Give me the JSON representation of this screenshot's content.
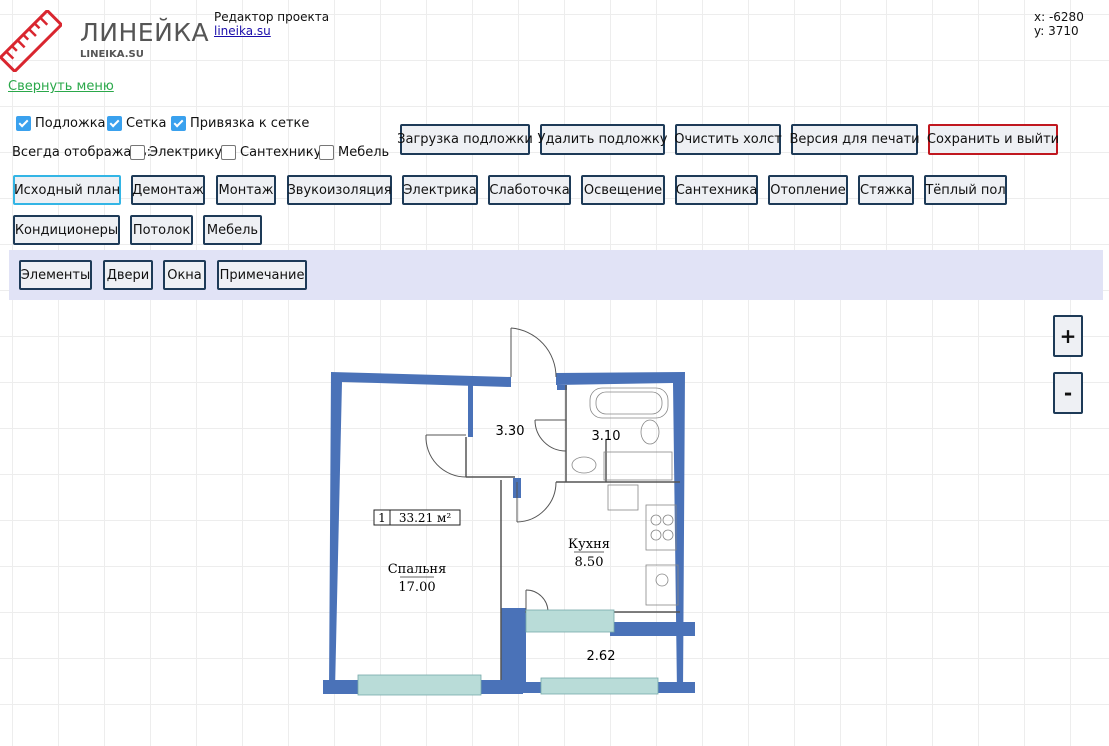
{
  "header": {
    "logo_title": "ЛИНЕЙКА",
    "logo_sub": "LINEIKA.SU",
    "project_title": "Редактор проекта",
    "project_link": "lineika.su",
    "coord_x": "x: -6280",
    "coord_y": "y: 3710",
    "collapse_menu": "Свернуть меню"
  },
  "options": {
    "underlay": "Подложка",
    "grid": "Сетка",
    "snap": "Привязка к сетке",
    "always_show": "Всегда отображать:",
    "electric": "Электрику",
    "plumbing": "Сантехнику",
    "furniture": "Мебель",
    "underlay_checked": true,
    "grid_checked": true,
    "snap_checked": true,
    "electric_checked": false,
    "plumbing_checked": false,
    "furniture_checked": false
  },
  "actions": {
    "load_underlay": "Загрузка подложки",
    "delete_underlay": "Удалить подложку",
    "clear_canvas": "Очистить холст",
    "print_version": "Версия для печати",
    "save_exit": "Сохранить и выйти"
  },
  "tabs": [
    "Исходный план",
    "Демонтаж",
    "Монтаж",
    "Звукоизоляция",
    "Электрика",
    "Слаботочка",
    "Освещение",
    "Сантехника",
    "Отопление",
    "Стяжка",
    "Тёплый пол",
    "Кондиционеры",
    "Потолок",
    "Мебель"
  ],
  "active_tab": "Исходный план",
  "subtools": [
    "Элементы",
    "Двери",
    "Окна",
    "Примечание"
  ],
  "zoom": {
    "in": "+",
    "out": "-"
  },
  "plan": {
    "apt_number": "1",
    "apt_area": "33.21 м²",
    "rooms": [
      {
        "name": "",
        "area": "3.30"
      },
      {
        "name": "",
        "area": "3.10"
      },
      {
        "name": "Кухня",
        "area": "8.50"
      },
      {
        "name": "Спальня",
        "area": "17.00"
      },
      {
        "name": "",
        "area": "2.62"
      }
    ]
  },
  "colors": {
    "wall": "#4a72b8",
    "window": "#b9dcd8",
    "active_border": "#33b5e5",
    "danger_border": "#c0171f",
    "link_green": "#2aa84a"
  }
}
